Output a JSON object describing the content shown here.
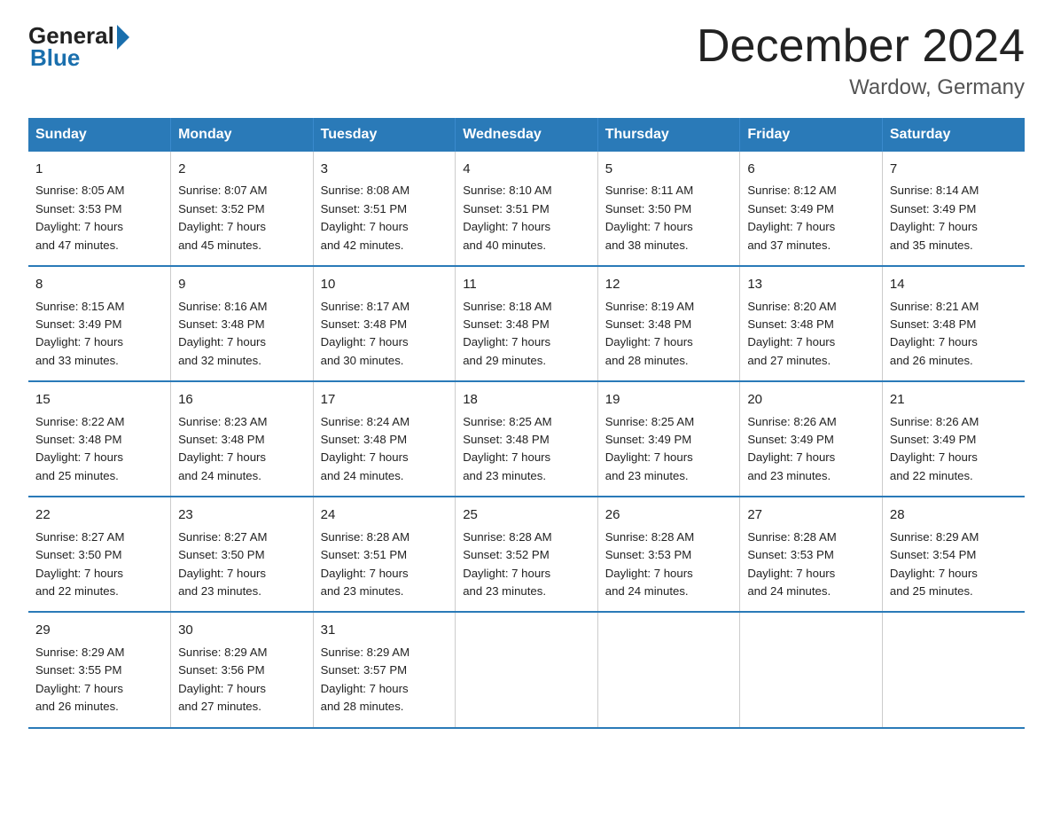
{
  "header": {
    "logo_general": "General",
    "logo_blue": "Blue",
    "title": "December 2024",
    "subtitle": "Wardow, Germany"
  },
  "columns": [
    "Sunday",
    "Monday",
    "Tuesday",
    "Wednesday",
    "Thursday",
    "Friday",
    "Saturday"
  ],
  "weeks": [
    [
      {
        "day": "1",
        "info": "Sunrise: 8:05 AM\nSunset: 3:53 PM\nDaylight: 7 hours\nand 47 minutes."
      },
      {
        "day": "2",
        "info": "Sunrise: 8:07 AM\nSunset: 3:52 PM\nDaylight: 7 hours\nand 45 minutes."
      },
      {
        "day": "3",
        "info": "Sunrise: 8:08 AM\nSunset: 3:51 PM\nDaylight: 7 hours\nand 42 minutes."
      },
      {
        "day": "4",
        "info": "Sunrise: 8:10 AM\nSunset: 3:51 PM\nDaylight: 7 hours\nand 40 minutes."
      },
      {
        "day": "5",
        "info": "Sunrise: 8:11 AM\nSunset: 3:50 PM\nDaylight: 7 hours\nand 38 minutes."
      },
      {
        "day": "6",
        "info": "Sunrise: 8:12 AM\nSunset: 3:49 PM\nDaylight: 7 hours\nand 37 minutes."
      },
      {
        "day": "7",
        "info": "Sunrise: 8:14 AM\nSunset: 3:49 PM\nDaylight: 7 hours\nand 35 minutes."
      }
    ],
    [
      {
        "day": "8",
        "info": "Sunrise: 8:15 AM\nSunset: 3:49 PM\nDaylight: 7 hours\nand 33 minutes."
      },
      {
        "day": "9",
        "info": "Sunrise: 8:16 AM\nSunset: 3:48 PM\nDaylight: 7 hours\nand 32 minutes."
      },
      {
        "day": "10",
        "info": "Sunrise: 8:17 AM\nSunset: 3:48 PM\nDaylight: 7 hours\nand 30 minutes."
      },
      {
        "day": "11",
        "info": "Sunrise: 8:18 AM\nSunset: 3:48 PM\nDaylight: 7 hours\nand 29 minutes."
      },
      {
        "day": "12",
        "info": "Sunrise: 8:19 AM\nSunset: 3:48 PM\nDaylight: 7 hours\nand 28 minutes."
      },
      {
        "day": "13",
        "info": "Sunrise: 8:20 AM\nSunset: 3:48 PM\nDaylight: 7 hours\nand 27 minutes."
      },
      {
        "day": "14",
        "info": "Sunrise: 8:21 AM\nSunset: 3:48 PM\nDaylight: 7 hours\nand 26 minutes."
      }
    ],
    [
      {
        "day": "15",
        "info": "Sunrise: 8:22 AM\nSunset: 3:48 PM\nDaylight: 7 hours\nand 25 minutes."
      },
      {
        "day": "16",
        "info": "Sunrise: 8:23 AM\nSunset: 3:48 PM\nDaylight: 7 hours\nand 24 minutes."
      },
      {
        "day": "17",
        "info": "Sunrise: 8:24 AM\nSunset: 3:48 PM\nDaylight: 7 hours\nand 24 minutes."
      },
      {
        "day": "18",
        "info": "Sunrise: 8:25 AM\nSunset: 3:48 PM\nDaylight: 7 hours\nand 23 minutes."
      },
      {
        "day": "19",
        "info": "Sunrise: 8:25 AM\nSunset: 3:49 PM\nDaylight: 7 hours\nand 23 minutes."
      },
      {
        "day": "20",
        "info": "Sunrise: 8:26 AM\nSunset: 3:49 PM\nDaylight: 7 hours\nand 23 minutes."
      },
      {
        "day": "21",
        "info": "Sunrise: 8:26 AM\nSunset: 3:49 PM\nDaylight: 7 hours\nand 22 minutes."
      }
    ],
    [
      {
        "day": "22",
        "info": "Sunrise: 8:27 AM\nSunset: 3:50 PM\nDaylight: 7 hours\nand 22 minutes."
      },
      {
        "day": "23",
        "info": "Sunrise: 8:27 AM\nSunset: 3:50 PM\nDaylight: 7 hours\nand 23 minutes."
      },
      {
        "day": "24",
        "info": "Sunrise: 8:28 AM\nSunset: 3:51 PM\nDaylight: 7 hours\nand 23 minutes."
      },
      {
        "day": "25",
        "info": "Sunrise: 8:28 AM\nSunset: 3:52 PM\nDaylight: 7 hours\nand 23 minutes."
      },
      {
        "day": "26",
        "info": "Sunrise: 8:28 AM\nSunset: 3:53 PM\nDaylight: 7 hours\nand 24 minutes."
      },
      {
        "day": "27",
        "info": "Sunrise: 8:28 AM\nSunset: 3:53 PM\nDaylight: 7 hours\nand 24 minutes."
      },
      {
        "day": "28",
        "info": "Sunrise: 8:29 AM\nSunset: 3:54 PM\nDaylight: 7 hours\nand 25 minutes."
      }
    ],
    [
      {
        "day": "29",
        "info": "Sunrise: 8:29 AM\nSunset: 3:55 PM\nDaylight: 7 hours\nand 26 minutes."
      },
      {
        "day": "30",
        "info": "Sunrise: 8:29 AM\nSunset: 3:56 PM\nDaylight: 7 hours\nand 27 minutes."
      },
      {
        "day": "31",
        "info": "Sunrise: 8:29 AM\nSunset: 3:57 PM\nDaylight: 7 hours\nand 28 minutes."
      },
      {
        "day": "",
        "info": ""
      },
      {
        "day": "",
        "info": ""
      },
      {
        "day": "",
        "info": ""
      },
      {
        "day": "",
        "info": ""
      }
    ]
  ]
}
